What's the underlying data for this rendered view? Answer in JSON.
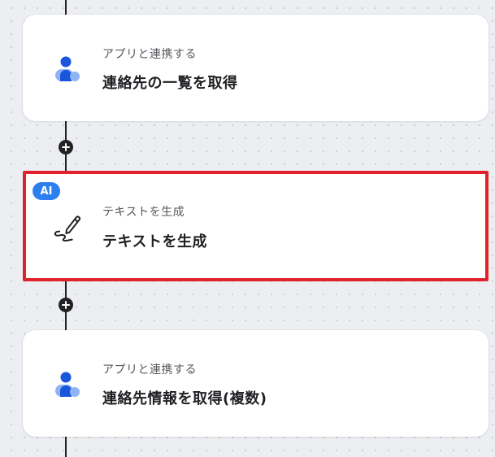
{
  "flow": {
    "steps": [
      {
        "subtitle": "アプリと連携する",
        "title": "連絡先の一覧を取得",
        "icon": "person-icon"
      },
      {
        "subtitle": "テキストを生成",
        "title": "テキストを生成",
        "icon": "pen-signature-icon",
        "badge": "AI",
        "selected": true
      },
      {
        "subtitle": "アプリと連携する",
        "title": "連絡先情報を取得(複数)",
        "icon": "person-icon"
      }
    ]
  },
  "colors": {
    "accent_blue": "#2d7ff0",
    "highlight_red": "#e0232b",
    "flow_line": "#222222",
    "person_icon_primary": "#1a56db",
    "person_icon_secondary": "#8fb4f5"
  }
}
